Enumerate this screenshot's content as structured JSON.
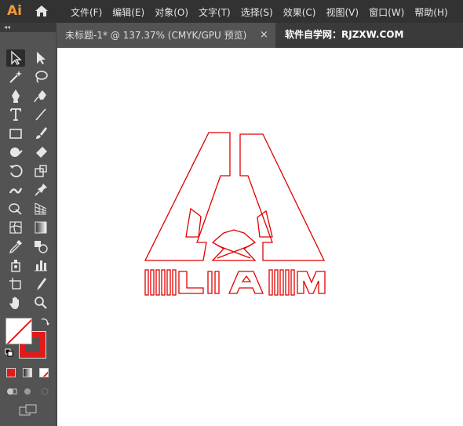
{
  "app": {
    "logo": "Ai"
  },
  "menu": [
    "文件(F)",
    "编辑(E)",
    "对象(O)",
    "文字(T)",
    "选择(S)",
    "效果(C)",
    "视图(V)",
    "窗口(W)",
    "帮助(H)"
  ],
  "document_tab": {
    "title": "未标题-1* @ 137.37% (CMYK/GPU 预览)",
    "close": "×"
  },
  "watermark": "软件自学网：RJZXW.COM",
  "toolbar": {
    "collapse": "◂◂",
    "tools": [
      "selection-tool",
      "direct-selection-tool",
      "magic-wand-tool",
      "lasso-tool",
      "pen-tool",
      "curvature-tool",
      "type-tool",
      "line-segment-tool",
      "rectangle-tool",
      "paintbrush-tool",
      "shaper-tool",
      "eraser-tool",
      "rotate-tool",
      "scale-tool",
      "warp-tool",
      "puppet-warp-tool",
      "shape-builder-tool",
      "perspective-grid-tool",
      "mesh-tool",
      "gradient-tool",
      "eyedropper-tool",
      "blend-tool",
      "symbol-sprayer-tool",
      "column-graph-tool",
      "artboard-tool",
      "slice-tool",
      "hand-tool",
      "zoom-tool"
    ]
  },
  "colors": {
    "artwork_stroke": "#e10000",
    "fill_swatch": "#ffffff",
    "stroke_swatch": "#e11b1b",
    "logo_color": "#f29a3a"
  },
  "artwork": {
    "text": "LAM"
  }
}
